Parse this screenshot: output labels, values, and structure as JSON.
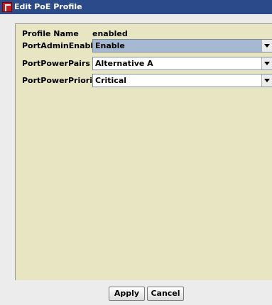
{
  "window": {
    "title": "Edit PoE Profile"
  },
  "form": {
    "profile_name": {
      "label": "Profile Name",
      "value": "enabled"
    },
    "admin_enable": {
      "label": "PortAdminEnable",
      "value": "Enable"
    },
    "power_pairs": {
      "label": "PortPowerPairs",
      "value": "Alternative A"
    },
    "power_priority": {
      "label": "PortPowerPriority",
      "value": "Critical"
    }
  },
  "buttons": {
    "apply": "Apply",
    "cancel": "Cancel"
  },
  "icons": {
    "app": "app-logo-icon",
    "dropdown": "chevron-down-icon"
  },
  "colors": {
    "titlebar": "#2a4a8a",
    "panel": "#e8e6c2",
    "selected_combo": "#a6b9d3"
  }
}
